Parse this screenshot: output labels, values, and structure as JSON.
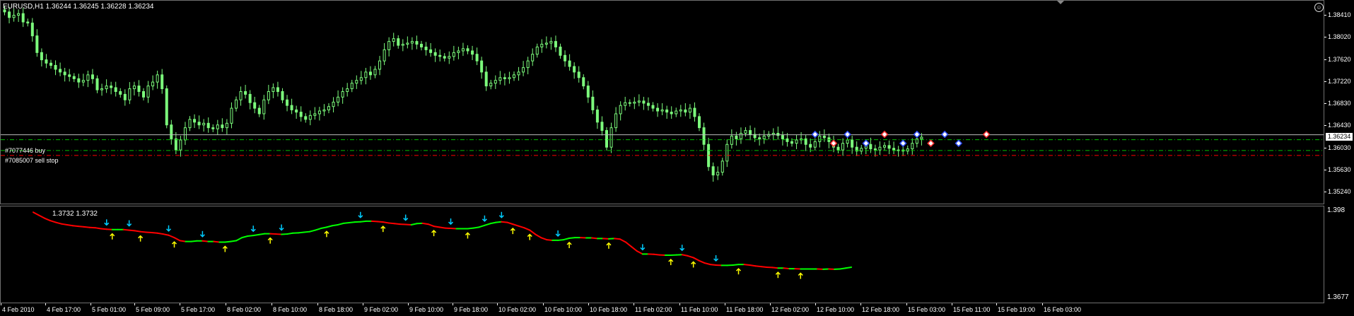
{
  "header": {
    "symbol_info": "EURUSD,H1  1.36244 1.36245 1.36228 1.36234",
    "indicator_values": "1.3732 1.3732"
  },
  "orders": [
    {
      "label": "#7077446 buy",
      "price": 1.36185
    },
    {
      "label": "#7085007 sell stop",
      "price": 1.3599
    }
  ],
  "price_axis": {
    "ticks": [
      "1.38410",
      "1.38020",
      "1.37620",
      "1.37220",
      "1.36830",
      "1.36430",
      "1.36030",
      "1.35630",
      "1.35240"
    ],
    "current_price": "1.36234"
  },
  "indicator_axis": {
    "top_label": "1.398",
    "bottom_label": "1.3677"
  },
  "time_axis": {
    "labels": [
      "4 Feb 2010",
      "4 Feb 17:00",
      "5 Feb 01:00",
      "5 Feb 09:00",
      "5 Feb 17:00",
      "8 Feb 02:00",
      "8 Feb 10:00",
      "8 Feb 18:00",
      "9 Feb 02:00",
      "9 Feb 10:00",
      "9 Feb 18:00",
      "10 Feb 02:00",
      "10 Feb 10:00",
      "10 Feb 18:00",
      "11 Feb 02:00",
      "11 Feb 10:00",
      "11 Feb 18:00",
      "12 Feb 02:00",
      "12 Feb 10:00",
      "12 Feb 18:00",
      "15 Feb 03:00",
      "15 Feb 11:00",
      "15 Feb 19:00",
      "16 Feb 03:00"
    ]
  },
  "colors": {
    "candle": "#7CFC7C",
    "bull": "#00FF00",
    "bear": "#FF0000",
    "buy_line": "#00C000",
    "sell_line": "#FF0000",
    "arrow_up": "#FFFF00",
    "arrow_down": "#00CCFF"
  },
  "chart_data": {
    "type": "candlestick",
    "symbol": "EURUSD",
    "timeframe": "H1",
    "ylim": [
      1.351,
      1.3858
    ],
    "close": [
      1.3848,
      1.3838,
      1.3842,
      1.3845,
      1.383,
      1.3828,
      1.3805,
      1.3775,
      1.3762,
      1.3756,
      1.3752,
      1.3745,
      1.374,
      1.3735,
      1.3732,
      1.3728,
      1.3722,
      1.3725,
      1.3735,
      1.3728,
      1.3708,
      1.371,
      1.3715,
      1.3712,
      1.3705,
      1.37,
      1.369,
      1.371,
      1.3715,
      1.3705,
      1.3695,
      1.3715,
      1.3722,
      1.3735,
      1.371,
      1.3645,
      1.362,
      1.36,
      1.3618,
      1.364,
      1.3655,
      1.365,
      1.3645,
      1.3648,
      1.364,
      1.3638,
      1.3645,
      1.364,
      1.3648,
      1.3675,
      1.369,
      1.3705,
      1.37,
      1.3685,
      1.3675,
      1.3665,
      1.369,
      1.3705,
      1.3712,
      1.3705,
      1.369,
      1.368,
      1.3672,
      1.3668,
      1.366,
      1.3655,
      1.3662,
      1.3665,
      1.367,
      1.3672,
      1.3678,
      1.3686,
      1.3695,
      1.3705,
      1.371,
      1.372,
      1.3725,
      1.373,
      1.374,
      1.3735,
      1.3745,
      1.376,
      1.378,
      1.3795,
      1.38,
      1.3788,
      1.379,
      1.3792,
      1.3795,
      1.379,
      1.3785,
      1.378,
      1.3775,
      1.377,
      1.3768,
      1.3765,
      1.3768,
      1.3775,
      1.3778,
      1.3782,
      1.3778,
      1.3772,
      1.376,
      1.374,
      1.3715,
      1.372,
      1.3725,
      1.373,
      1.3728,
      1.373,
      1.3735,
      1.374,
      1.3748,
      1.376,
      1.3772,
      1.3785,
      1.379,
      1.3792,
      1.3795,
      1.3785,
      1.377,
      1.376,
      1.375,
      1.374,
      1.373,
      1.3715,
      1.3695,
      1.3672,
      1.365,
      1.3635,
      1.3605,
      1.364,
      1.3665,
      1.368,
      1.3685,
      1.3684,
      1.3686,
      1.3688,
      1.3684,
      1.368,
      1.3675,
      1.367,
      1.3672,
      1.3668,
      1.3665,
      1.367,
      1.3672,
      1.3668,
      1.3675,
      1.366,
      1.364,
      1.361,
      1.357,
      1.3555,
      1.356,
      1.358,
      1.361,
      1.3625,
      1.362,
      1.363,
      1.3635,
      1.3628,
      1.3622,
      1.362,
      1.3625,
      1.3628,
      1.363,
      1.3626,
      1.362,
      1.3615,
      1.3612,
      1.3618,
      1.362,
      1.361,
      1.3605,
      1.3615,
      1.3625,
      1.3622,
      1.3615,
      1.3605,
      1.36,
      1.3612,
      1.3618,
      1.3605,
      1.3598,
      1.3603,
      1.361,
      1.3602,
      1.36,
      1.3605,
      1.3608,
      1.3603,
      1.36,
      1.36,
      1.3598,
      1.3602,
      1.3612,
      1.362,
      1.3623
    ]
  },
  "indicator_data": {
    "type": "line",
    "ylim": [
      1.3677,
      1.398
    ],
    "values": [
      1.397,
      1.396,
      1.395,
      1.3942,
      1.3936,
      1.3931,
      1.3928,
      1.3925,
      1.3923,
      1.3921,
      1.3919,
      1.3918,
      1.3915,
      1.3913,
      1.3912,
      1.3912,
      1.3912,
      1.391,
      1.3908,
      1.3905,
      1.3903,
      1.3902,
      1.39,
      1.3897,
      1.3893,
      1.3885,
      1.3875,
      1.3872,
      1.3872,
      1.3874,
      1.3874,
      1.3872,
      1.3872,
      1.387,
      1.387,
      1.3872,
      1.3875,
      1.3885,
      1.389,
      1.3892,
      1.3895,
      1.3898,
      1.3898,
      1.3897,
      1.3896,
      1.3897,
      1.39,
      1.3901,
      1.3903,
      1.3905,
      1.391,
      1.3916,
      1.392,
      1.3925,
      1.3928,
      1.3933,
      1.3935,
      1.3937,
      1.3938,
      1.394,
      1.394,
      1.3939,
      1.3937,
      1.3934,
      1.3932,
      1.393,
      1.3929,
      1.3928,
      1.3932,
      1.3933,
      1.393,
      1.3923,
      1.392,
      1.3917,
      1.3916,
      1.3915,
      1.3915,
      1.3915,
      1.3917,
      1.392,
      1.3926,
      1.3932,
      1.3936,
      1.3938,
      1.3936,
      1.393,
      1.3924,
      1.3918,
      1.391,
      1.3896,
      1.3885,
      1.3878,
      1.3876,
      1.3876,
      1.3878,
      1.3883,
      1.3885,
      1.3885,
      1.3884,
      1.3884,
      1.3882,
      1.3882,
      1.3881,
      1.3882,
      1.388,
      1.387,
      1.3855,
      1.384,
      1.383,
      1.383,
      1.3829,
      1.3827,
      1.3826,
      1.3826,
      1.3827,
      1.3828,
      1.3824,
      1.3818,
      1.3808,
      1.38,
      1.3795,
      1.3793,
      1.3792,
      1.3792,
      1.3793,
      1.3795,
      1.3795,
      1.3793,
      1.379,
      1.3788,
      1.3786,
      1.3785,
      1.3783,
      1.3783,
      1.3781,
      1.3781,
      1.378,
      1.378,
      1.378,
      1.378,
      1.3779,
      1.378,
      1.3779,
      1.378,
      1.3783,
      1.3786
    ],
    "up_arrows": [
      14,
      19,
      25,
      34,
      42,
      52,
      62,
      71,
      77,
      85,
      88,
      95,
      102,
      113,
      117,
      125,
      132,
      136
    ],
    "down_arrows": [
      13,
      17,
      24,
      30,
      39,
      44,
      58,
      66,
      74,
      80,
      83,
      93,
      108,
      115,
      121
    ]
  }
}
